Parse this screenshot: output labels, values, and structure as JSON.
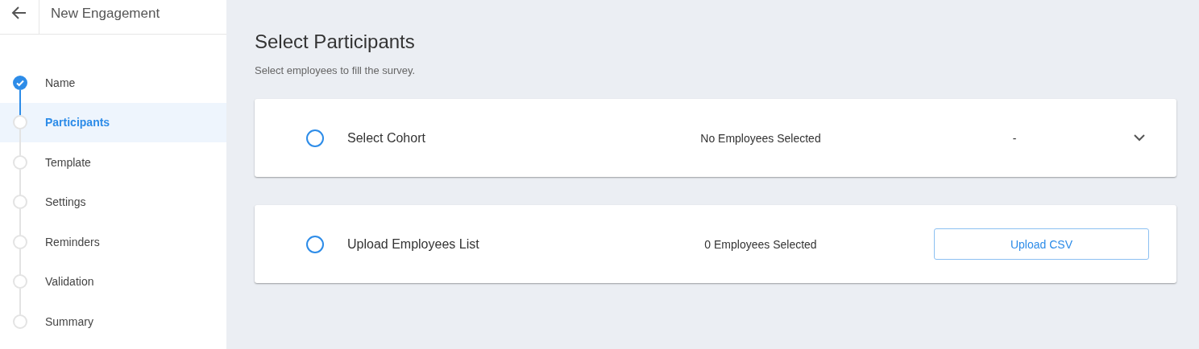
{
  "header": {
    "title": "New Engagement"
  },
  "steps": [
    {
      "label": "Name",
      "completed": true,
      "selected": false
    },
    {
      "label": "Participants",
      "completed": false,
      "selected": true
    },
    {
      "label": "Template",
      "completed": false,
      "selected": false
    },
    {
      "label": "Settings",
      "completed": false,
      "selected": false
    },
    {
      "label": "Reminders",
      "completed": false,
      "selected": false
    },
    {
      "label": "Validation",
      "completed": false,
      "selected": false
    },
    {
      "label": "Summary",
      "completed": false,
      "selected": false
    }
  ],
  "page": {
    "title": "Select Participants",
    "subtitle": "Select employees to fill the survey."
  },
  "options": [
    {
      "kind": "dropdown",
      "label": "Select Cohort",
      "selected": false,
      "count": "No Employees Selected",
      "value": "-"
    },
    {
      "kind": "upload",
      "label": "Upload Employees List",
      "selected": false,
      "count": "0 Employees Selected",
      "button": "Upload CSV"
    }
  ]
}
